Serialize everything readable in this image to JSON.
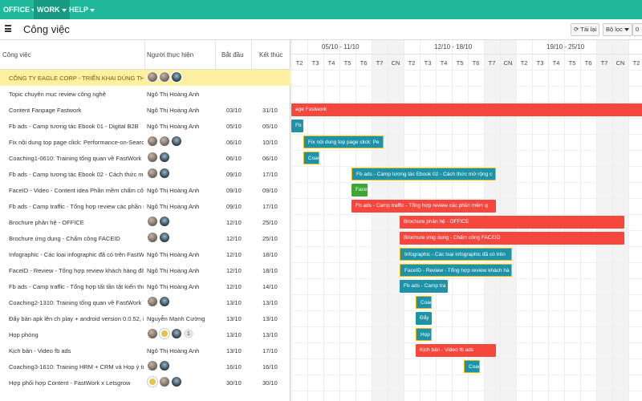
{
  "topnav": {
    "menus": [
      "OFFICE",
      "WORK",
      "HELP"
    ]
  },
  "title": "Công việc",
  "buttons": {
    "reload": "Tải lại",
    "filter": "Bộ lọc",
    "extra": "0"
  },
  "columns": {
    "task": "Công việc",
    "assignee": "Người thực hiện",
    "start": "Bắt đầu",
    "end": "Kết thúc"
  },
  "weeks": [
    "05/10 - 11/10",
    "12/10 - 18/10",
    "19/10 - 25/10"
  ],
  "days": [
    "T2",
    "T3",
    "T4",
    "T5",
    "T6",
    "T7",
    "CN",
    "T2",
    "T3",
    "T4",
    "T5",
    "T6",
    "T7",
    "CN",
    "T2",
    "T3",
    "T4",
    "T5",
    "T6",
    "T7",
    "CN",
    "T2"
  ],
  "rows": [
    {
      "task": "CÔNG TY EAGLE CORP - TRIỂN KHAI DÙNG THẬT",
      "assignee": "",
      "avatars": [
        "a1",
        "a1",
        "a2"
      ],
      "start": "",
      "end": "",
      "company": true
    },
    {
      "task": "Topic chuyên mục review công nghệ",
      "assignee": "Ngô Thị Hoàng Anh",
      "start": "",
      "end": ""
    },
    {
      "task": "Content Fanpage Fastwork",
      "assignee": "Ngô Thị Hoàng Anh",
      "start": "03/10",
      "end": "31/10"
    },
    {
      "task": "Fb ads - Camp tương tác Ebook 01 - Digital B2B",
      "assignee": "Ngô Thị Hoàng Anh",
      "start": "05/10",
      "end": "05/10"
    },
    {
      "task": "Fix nội dung top page click: Performance-on-Search",
      "assignee": "",
      "avatars": [
        "a1",
        "a1",
        "a2"
      ],
      "start": "06/10",
      "end": "10/10"
    },
    {
      "task": "Coaching1-0610: Training tổng quan về FastWork - V",
      "assignee": "",
      "avatars": [
        "a1",
        "a2"
      ],
      "start": "06/10",
      "end": "06/10"
    },
    {
      "task": "Fb ads - Camp tương tác Ebook 02 - Cách thức mở rộng",
      "assignee": "",
      "avatars": [
        "a1",
        "a2"
      ],
      "start": "09/10",
      "end": "17/10"
    },
    {
      "task": "FaceID - Video - Content idea Phần mềm chấm công",
      "assignee": "Ngô Thị Hoàng Anh",
      "start": "09/10",
      "end": "09/10"
    },
    {
      "task": "Fb ads - Camp traffic - Tổng hợp review các phần mềm",
      "assignee": "Ngô Thị Hoàng Anh",
      "start": "09/10",
      "end": "17/10"
    },
    {
      "task": "Brochure phân hệ - OFFICE",
      "assignee": "",
      "avatars": [
        "a1",
        "a2"
      ],
      "start": "12/10",
      "end": "25/10"
    },
    {
      "task": "Brochure ứng dụng - Chấm công FACEID",
      "assignee": "",
      "avatars": [
        "a1",
        "a2"
      ],
      "start": "12/10",
      "end": "25/10"
    },
    {
      "task": "Infographic - Các loại infographic đã có trên FastW",
      "assignee": "Ngô Thị Hoàng Anh",
      "start": "12/10",
      "end": "18/10"
    },
    {
      "task": "FaceID - Review - Tổng hợp review khách hàng đã sử",
      "assignee": "Ngô Thị Hoàng Anh",
      "start": "12/10",
      "end": "18/10"
    },
    {
      "task": "Fb ads - Camp traffic - Tổng hợp tất tần tật kiến thức",
      "assignee": "Ngô Thị Hoàng Anh",
      "start": "12/10",
      "end": "14/10"
    },
    {
      "task": "Coaching2-1310: Training tổng quan về FastWork W",
      "assignee": "",
      "avatars": [
        "a1",
        "a2"
      ],
      "start": "13/10",
      "end": "13/10"
    },
    {
      "task": "Đẩy bản apk lên ch play + android version 0.0.52, ic",
      "assignee": "Nguyễn Mạnh Cường",
      "start": "13/10",
      "end": "13/10"
    },
    {
      "task": "Họp phòng",
      "assignee": "",
      "avatars": [
        "a1",
        "a3",
        "a2"
      ],
      "avatar_more": "1",
      "start": "13/10",
      "end": "13/10"
    },
    {
      "task": "Kịch bản - Video fb ads",
      "assignee": "Ngô Thị Hoàng Anh",
      "start": "13/10",
      "end": "17/10"
    },
    {
      "task": "Coaching3-1610: Training HRM + CRM và Họp ý tướ",
      "assignee": "",
      "avatars": [
        "a1",
        "a2"
      ],
      "start": "16/10",
      "end": "16/10"
    },
    {
      "task": "Hợp phối hợp Content - FastWork x Letsgrow",
      "assignee": "",
      "avatars": [
        "a3",
        "a1",
        "a2"
      ],
      "start": "30/10",
      "end": "30/10"
    }
  ],
  "bars": [
    {
      "row": 2,
      "label": "age Fastwork",
      "color": "red",
      "startDay": 0,
      "span": 22
    },
    {
      "row": 3,
      "label": "Fb ads",
      "color": "teal",
      "startDay": 0,
      "span": 0.75
    },
    {
      "row": 4,
      "label": "Fix nội dung top page click: Pe",
      "color": "teal",
      "startDay": 0.75,
      "span": 5,
      "border": true
    },
    {
      "row": 5,
      "label": "Coaching",
      "color": "teal",
      "startDay": 0.75,
      "span": 1,
      "border": true
    },
    {
      "row": 6,
      "label": "Fb ads - Camp tương tác Ebook 02 - Cách thức mở rộng c",
      "color": "teal",
      "startDay": 3.75,
      "span": 9,
      "border": true
    },
    {
      "row": 7,
      "label": "FaceID",
      "color": "green",
      "startDay": 3.75,
      "span": 1
    },
    {
      "row": 8,
      "label": "Fb ads - Camp traffic - Tổng hợp review các phần mềm q",
      "color": "red",
      "startDay": 3.75,
      "span": 9
    },
    {
      "row": 9,
      "label": "Brochure phân hệ - OFFICE",
      "color": "red",
      "startDay": 6.75,
      "span": 14
    },
    {
      "row": 10,
      "label": "Brochure ứng dụng - Chấm công FACEID",
      "color": "red",
      "startDay": 6.75,
      "span": 14
    },
    {
      "row": 11,
      "label": "Infographic - Các loại infographic đã có trên",
      "color": "teal",
      "startDay": 6.75,
      "span": 7,
      "border": true
    },
    {
      "row": 12,
      "label": "FaceID - Review - Tổng hợp review khách hà",
      "color": "teal",
      "startDay": 6.75,
      "span": 7,
      "border": true
    },
    {
      "row": 13,
      "label": "Fb ads - Camp tra",
      "color": "teal",
      "startDay": 6.75,
      "span": 3
    },
    {
      "row": 14,
      "label": "Coach",
      "color": "teal",
      "startDay": 7.75,
      "span": 1,
      "border": true
    },
    {
      "row": 15,
      "label": "Đẩy",
      "color": "teal",
      "startDay": 7.75,
      "span": 1
    },
    {
      "row": 16,
      "label": "Họp",
      "color": "teal",
      "startDay": 7.75,
      "span": 1,
      "border": true
    },
    {
      "row": 17,
      "label": "Kịch bản - Video fb ads",
      "color": "red",
      "startDay": 7.75,
      "span": 5
    },
    {
      "row": 18,
      "label": "Coach",
      "color": "teal",
      "startDay": 10.75,
      "span": 1,
      "border": true
    }
  ]
}
